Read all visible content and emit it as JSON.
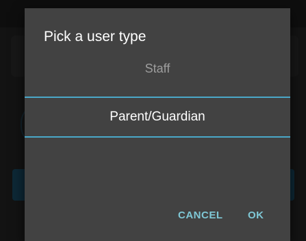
{
  "dialog": {
    "title": "Pick a user type",
    "options": [
      {
        "label": "Staff",
        "selected": false
      },
      {
        "label": "Parent/Guardian",
        "selected": true
      }
    ],
    "cancel_label": "CANCEL",
    "ok_label": "OK"
  },
  "colors": {
    "accent": "#4aa8c9",
    "action_text": "#7fc8d6",
    "dialog_bg": "#424242"
  }
}
